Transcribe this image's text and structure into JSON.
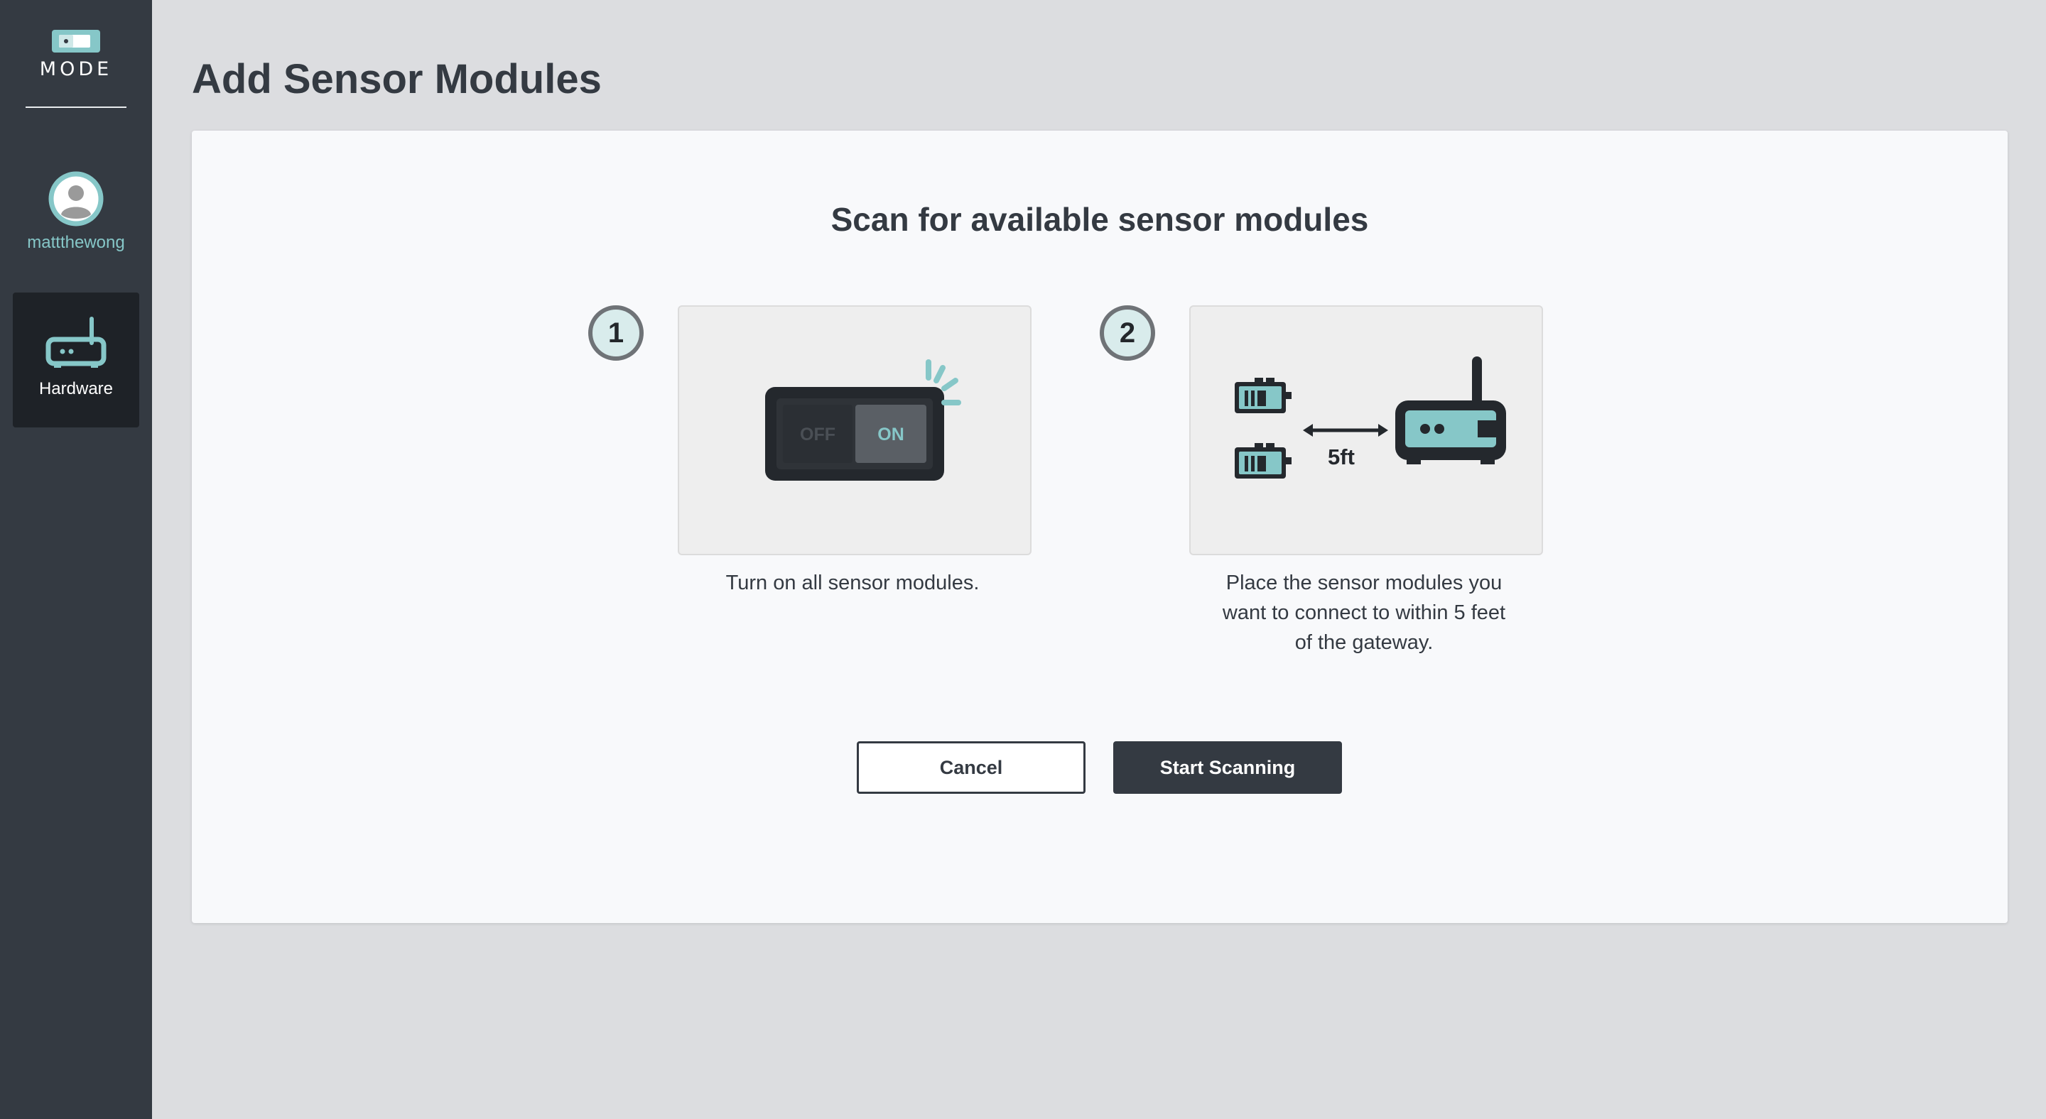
{
  "sidebar": {
    "logo_text": "MODE",
    "user": {
      "name": "mattthewong"
    },
    "nav": [
      {
        "label": "Hardware",
        "icon": "router-icon",
        "active": true
      }
    ]
  },
  "page": {
    "title": "Add Sensor Modules"
  },
  "card": {
    "title": "Scan for available sensor modules",
    "steps": [
      {
        "number": "1",
        "text": "Turn on all sensor modules.",
        "illustration": {
          "icon": "power-switch-icon",
          "off_label": "OFF",
          "on_label": "ON"
        }
      },
      {
        "number": "2",
        "text_lines": [
          "Place the sensor modules you",
          "want to connect to within 5 feet",
          "of the gateway."
        ],
        "illustration": {
          "icon": "sensor-gateway-distance-icon",
          "distance_label": "5ft"
        }
      }
    ],
    "buttons": {
      "cancel": "Cancel",
      "start": "Start Scanning"
    }
  },
  "colors": {
    "sidebar": "#343a42",
    "accent": "#86c7c8",
    "primary_button": "#343a42"
  }
}
